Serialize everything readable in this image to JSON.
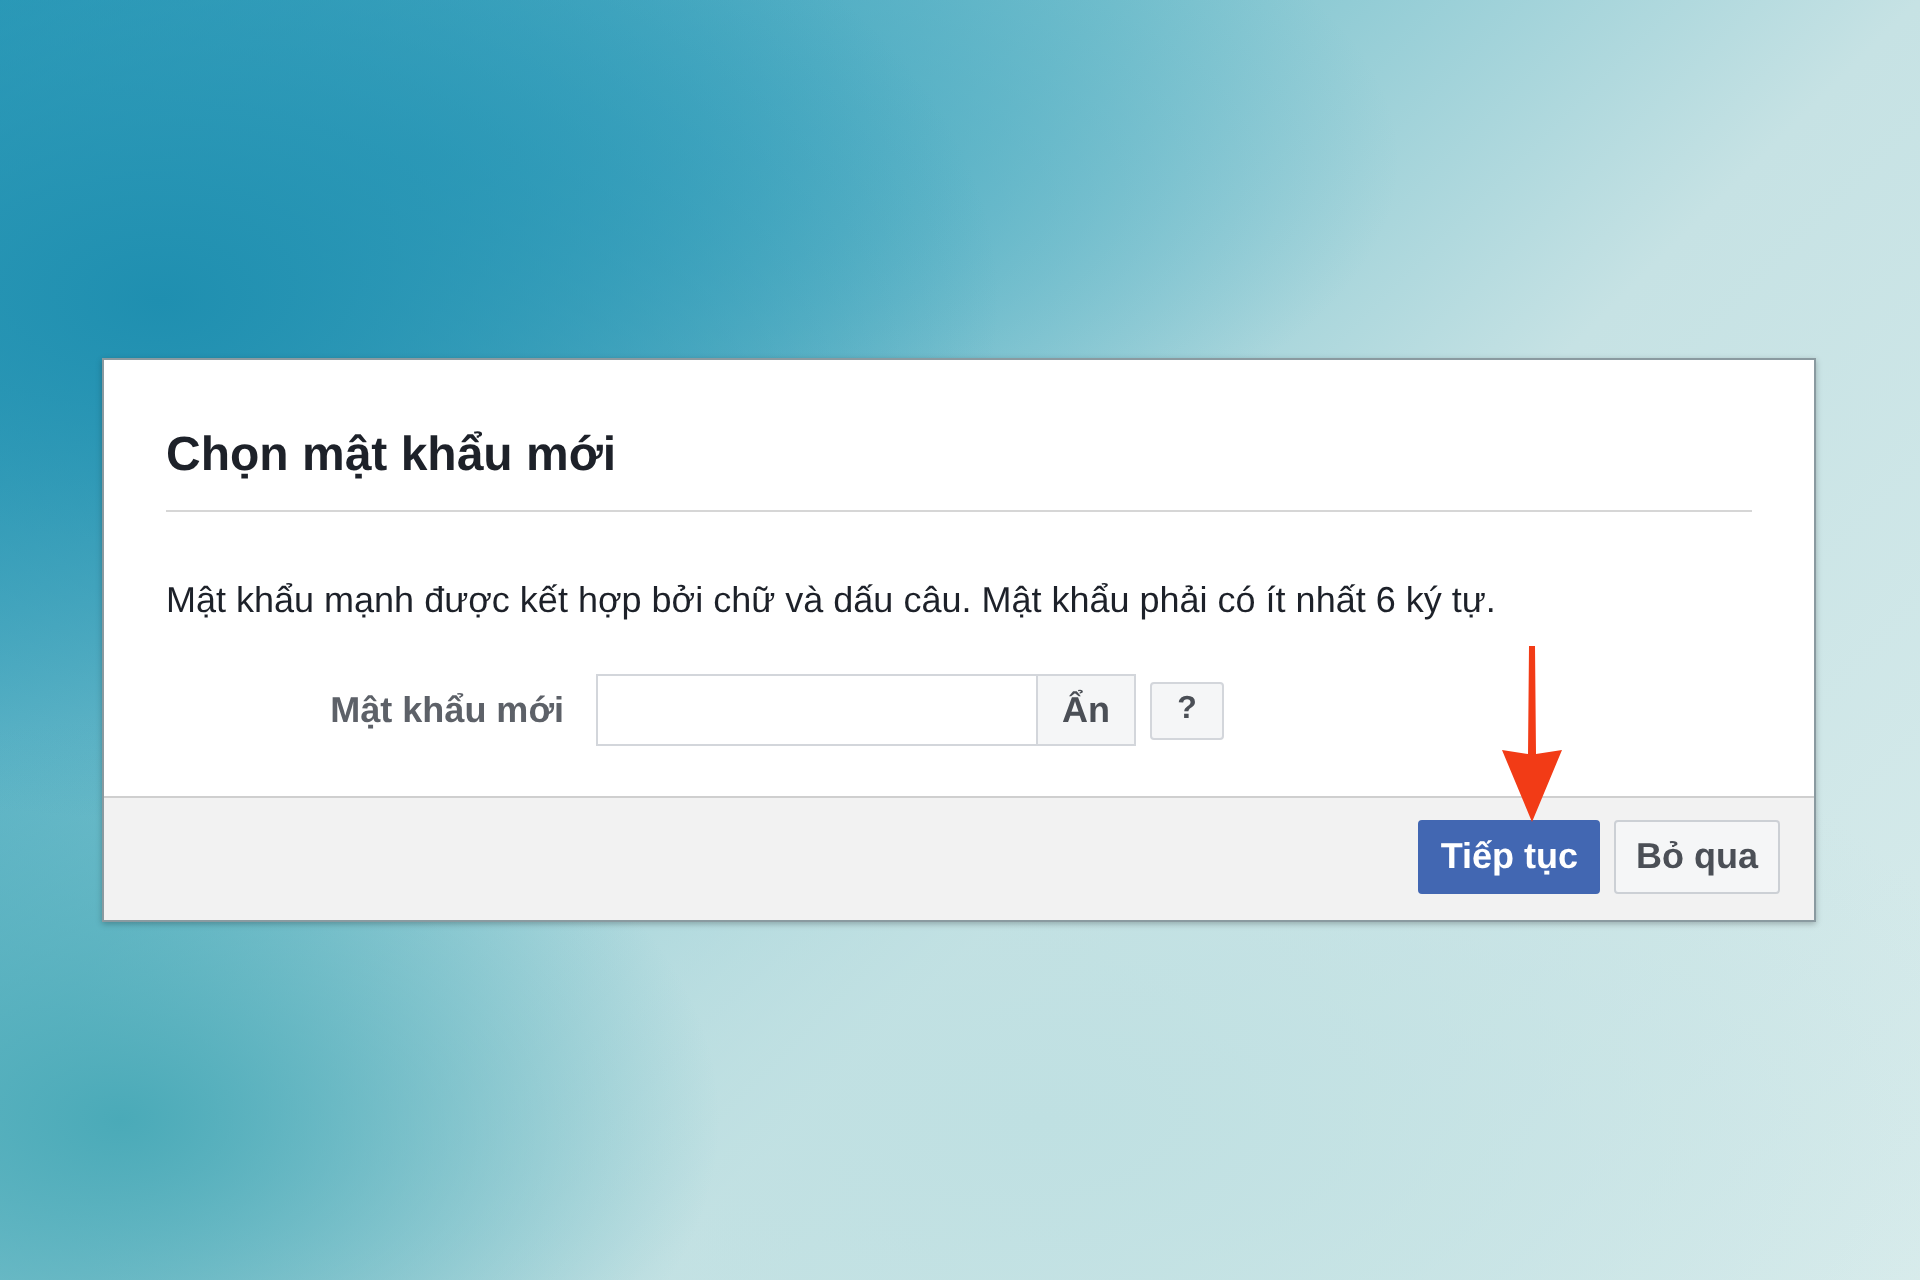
{
  "dialog": {
    "title": "Chọn mật khẩu mới",
    "description": "Mật khẩu mạnh được kết hợp bởi chữ và dấu câu. Mật khẩu phải có ít nhất 6 ký tự.",
    "password_field": {
      "label": "Mật khẩu mới",
      "toggle_button": "Ẩn",
      "help_button": "?"
    },
    "buttons": [
      {
        "label": "Tiếp tục",
        "kind": "primary"
      },
      {
        "label": "Bỏ qua",
        "kind": "secondary"
      }
    ]
  }
}
